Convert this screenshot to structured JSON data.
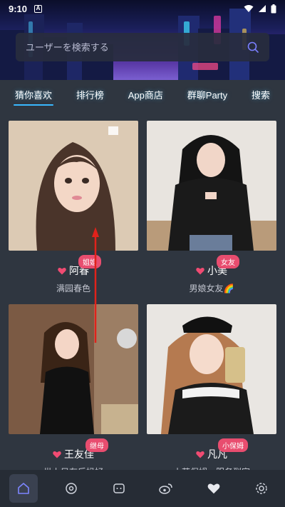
{
  "status": {
    "time": "9:10",
    "a_label": "A"
  },
  "search": {
    "placeholder": "ユーザーを検索する"
  },
  "tabs": [
    {
      "label": "猜你喜欢"
    },
    {
      "label": "排行榜"
    },
    {
      "label": "App商店"
    },
    {
      "label": "群聊Party"
    },
    {
      "label": "搜索"
    }
  ],
  "cards": [
    {
      "name": "阿春",
      "badge": "姐姐",
      "subtitle": "满园春色"
    },
    {
      "name": "小美",
      "badge": "女友",
      "subtitle": "男娘女友🌈"
    },
    {
      "name": "王友佳",
      "badge": "继母",
      "subtitle": "世上只有后妈好"
    },
    {
      "name": "凡凡",
      "badge": "小保姆",
      "subtitle": "小萌保姆，服务到家"
    }
  ],
  "nav": [
    {
      "icon": "home-icon"
    },
    {
      "icon": "eye-icon"
    },
    {
      "icon": "chat-icon"
    },
    {
      "icon": "weibo-icon"
    },
    {
      "icon": "heart-icon"
    },
    {
      "icon": "settings-icon"
    }
  ],
  "colors": {
    "accent": "#39b8ff",
    "badge": "#e84d6f",
    "bg": "#2f3640",
    "nav_bg": "#262c35"
  }
}
